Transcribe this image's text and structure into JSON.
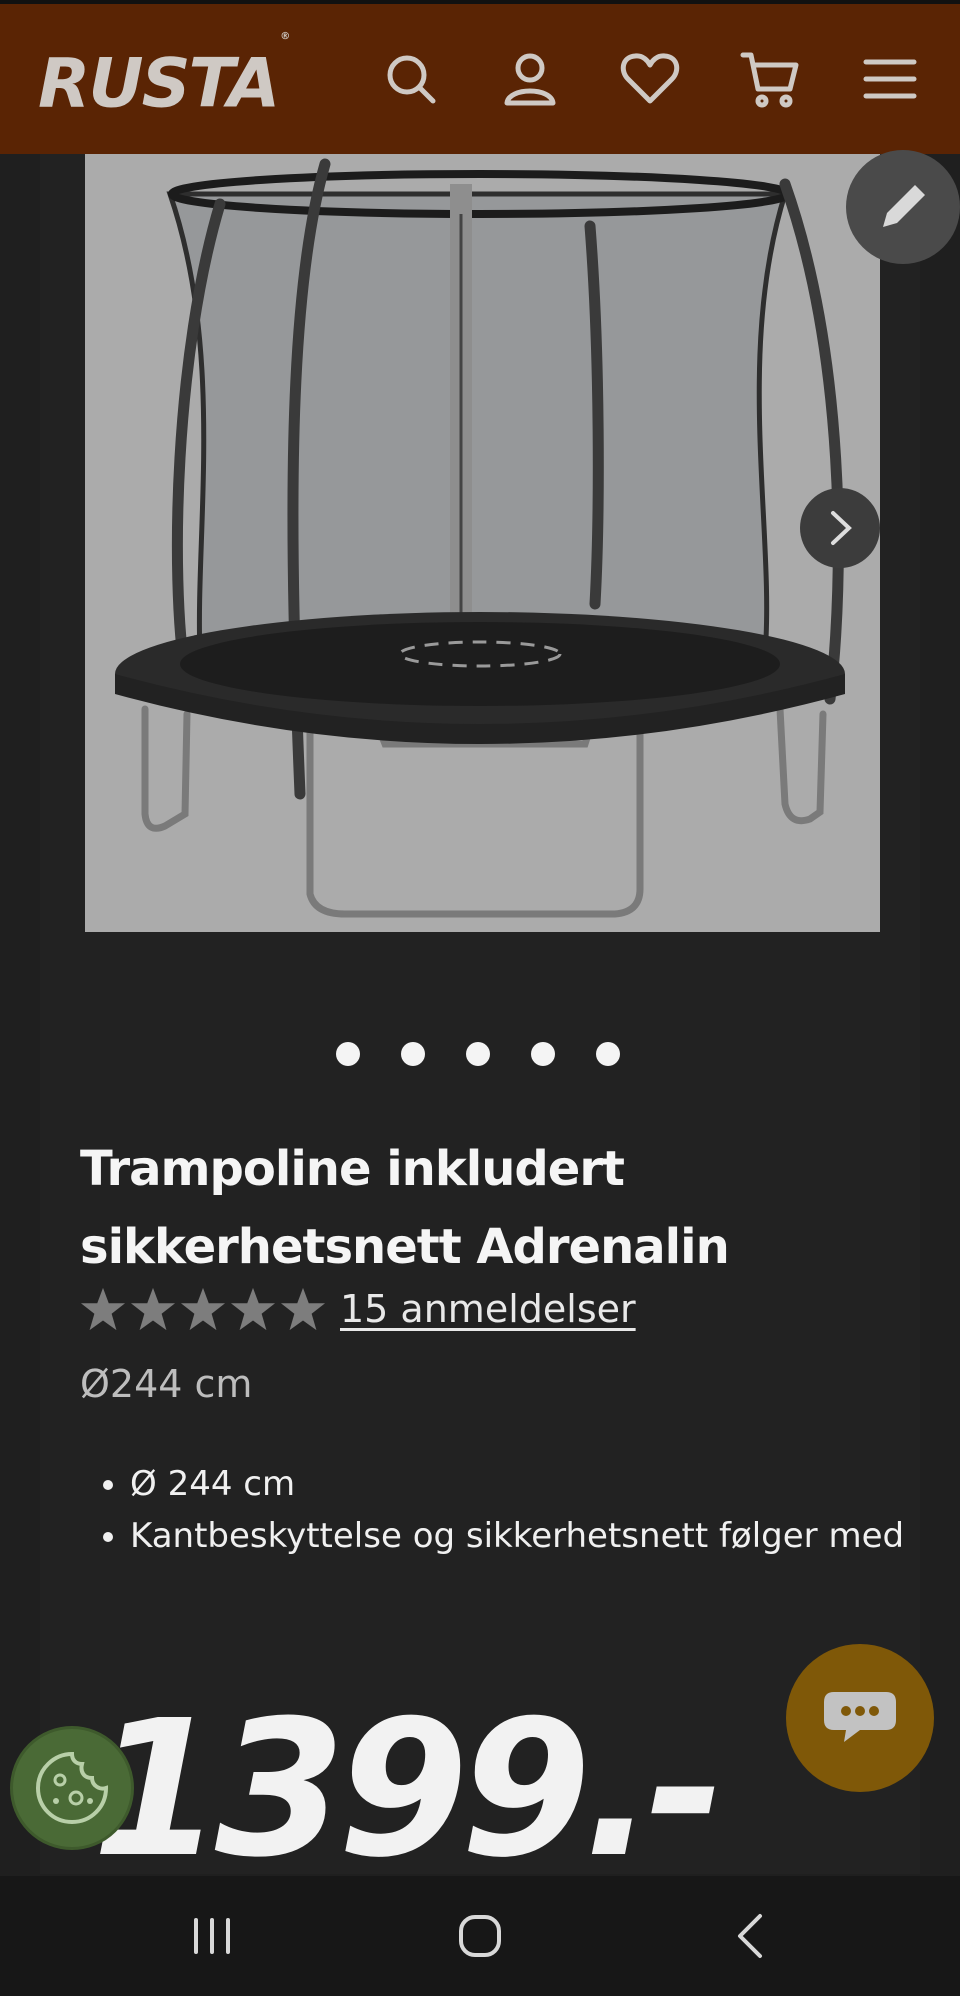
{
  "header": {
    "logo_text": "RUSTA",
    "logo_mark": "®",
    "icons": [
      "search-icon",
      "account-icon",
      "heart-icon",
      "cart-icon",
      "menu-icon"
    ]
  },
  "gallery": {
    "image_alt": "Trampoline inkludert sikkerhetsnett Adrenalin",
    "dot_count": 5
  },
  "product": {
    "title": "Trampoline inkludert sikkerhetsnett Adrenalin",
    "rating_stars": 5,
    "reviews_text": "15 anmeldelser",
    "variant": "Ø244 cm",
    "bullets": [
      "Ø 244 cm",
      "Kantbeskyttelse og sikkerhetsnett følger med"
    ],
    "price": "1399.-"
  },
  "colors": {
    "header_bg": "#5a2404",
    "page_bg": "#1f1f1f",
    "chat_button": "#7f5808",
    "cookie_button": "#4a6a36"
  }
}
